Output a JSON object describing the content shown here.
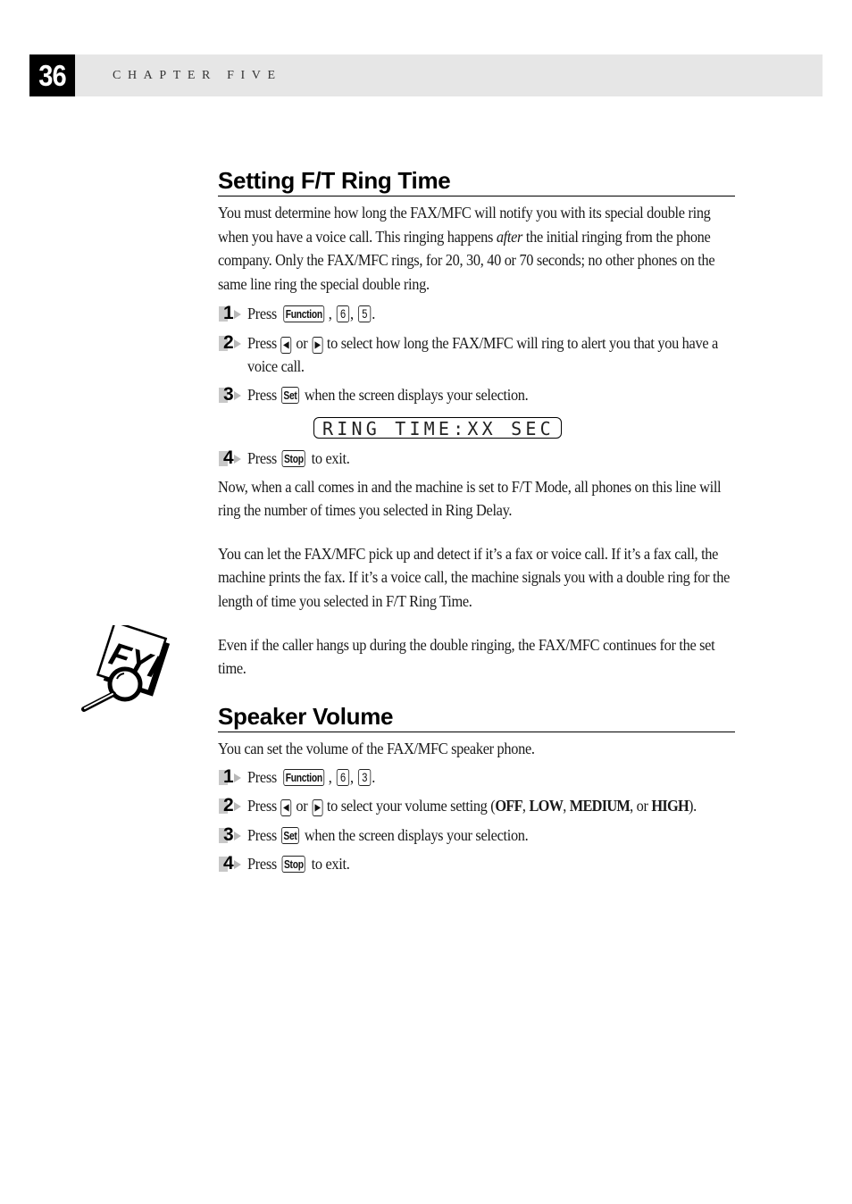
{
  "header": {
    "page_number": "36",
    "chapter": "CHAPTER FIVE"
  },
  "section1": {
    "title": "Setting F/T Ring Time",
    "intro_before_italic": "You must determine how long the FAX/MFC will notify you with its special double ring when you have a voice call. This ringing happens ",
    "intro_italic": "after",
    "intro_after_italic": " the initial ringing from the phone company. Only the FAX/MFC rings, for 20, 30, 40 or 70 seconds; no other phones on the same line ring the special double ring.",
    "steps": [
      {
        "num": "1",
        "press": "Press",
        "keys": [
          "Function",
          "6",
          "5"
        ]
      },
      {
        "num": "2",
        "press": "Press",
        "or": "or",
        "text": "to select how long the FAX/MFC will ring to alert you that you have a voice call."
      },
      {
        "num": "3",
        "press": "Press",
        "key": "Set",
        "text": "when the screen displays your selection."
      },
      {
        "num": "4",
        "press": "Press",
        "key": "Stop",
        "text": "to exit."
      }
    ],
    "lcd_display": "RING TIME:XX SEC",
    "after_steps": "Now, when a call comes in and the machine is set to F/T Mode, all phones on this line will ring the number of times you selected in Ring Delay.",
    "para2": "You can let the FAX/MFC pick up and detect if it’s a fax or voice call. If it’s a fax call, the machine prints the fax. If it’s a voice call, the machine signals you with a double ring for the length of time you selected in F/T Ring Time.",
    "fyi_note": "Even if the caller hangs up during the double ringing, the FAX/MFC continues for the set time.",
    "fyi_icon": "fyi-magnifier-icon"
  },
  "section2": {
    "title": "Speaker Volume",
    "intro": "You can set the volume of the FAX/MFC speaker phone.",
    "steps": [
      {
        "num": "1",
        "press": "Press",
        "keys": [
          "Function",
          "6",
          "3"
        ]
      },
      {
        "num": "2",
        "press": "Press",
        "or": "or",
        "text_before": "to select your volume setting (",
        "options": [
          "OFF",
          "LOW",
          "MEDIUM",
          "HIGH"
        ],
        "sep1": ", ",
        "sep2": ", ",
        "sep3": ", or ",
        "text_after": ")."
      },
      {
        "num": "3",
        "press": "Press",
        "key": "Set",
        "text": "when the screen displays your selection."
      },
      {
        "num": "4",
        "press": "Press",
        "key": "Stop",
        "text": "to exit."
      }
    ]
  },
  "glyphs": {
    "left_arrow": "◀",
    "right_arrow": "▶",
    "comma": ",",
    "period": "."
  }
}
